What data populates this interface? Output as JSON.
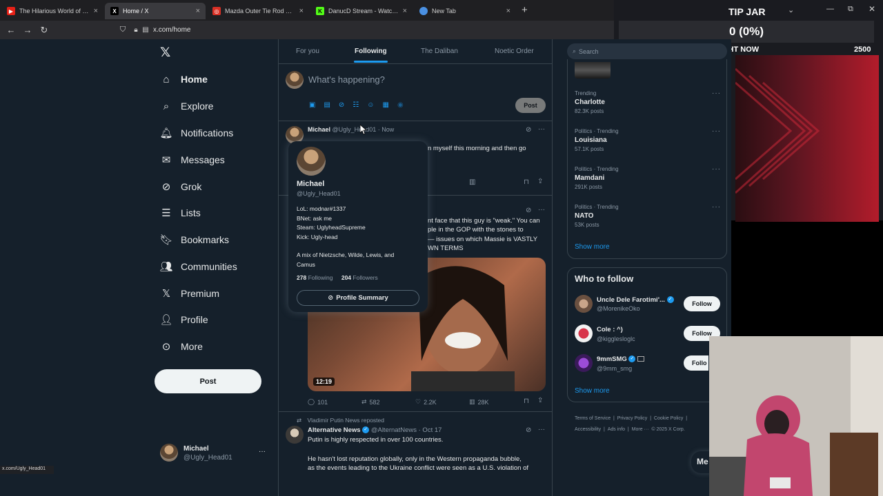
{
  "browser": {
    "tabs": [
      {
        "title": "The Hilarious World of Fun",
        "favicon": "youtube-icon",
        "color": "#e62117"
      },
      {
        "title": "Home / X",
        "favicon": "x-icon",
        "color": "#000000",
        "active": true
      },
      {
        "title": "Mazda Outer Tie Rod Replacem",
        "favicon": "red-icon",
        "color": "#d93025"
      },
      {
        "title": "DanucD Stream - Watch Li",
        "favicon": "kick-icon",
        "color": "#53fc18"
      },
      {
        "title": "New Tab",
        "favicon": "newtab-icon",
        "color": "#4a90e2"
      }
    ],
    "url": "x.com/home",
    "status_url": "x.com/Ugly_Head01"
  },
  "overlay": {
    "title": "TIP JAR",
    "amount": "0 (0%)",
    "min": "0",
    "label": "RIGHT NOW",
    "max": "2500"
  },
  "sidebar": {
    "items": [
      {
        "label": "Home",
        "icon": "home-icon"
      },
      {
        "label": "Explore",
        "icon": "search-icon"
      },
      {
        "label": "Notifications",
        "icon": "bell-icon"
      },
      {
        "label": "Messages",
        "icon": "mail-icon"
      },
      {
        "label": "Grok",
        "icon": "grok-icon"
      },
      {
        "label": "Lists",
        "icon": "list-icon"
      },
      {
        "label": "Bookmarks",
        "icon": "bookmark-icon"
      },
      {
        "label": "Communities",
        "icon": "communities-icon"
      },
      {
        "label": "Premium",
        "icon": "x-icon"
      },
      {
        "label": "Profile",
        "icon": "person-icon"
      },
      {
        "label": "More",
        "icon": "more-icon"
      }
    ],
    "post_label": "Post",
    "account": {
      "name": "Michael",
      "handle": "@Ugly_Head01"
    }
  },
  "feed": {
    "tabs": [
      "For you",
      "Following",
      "The Daliban",
      "Noetic Order"
    ],
    "compose_placeholder": "What's happening?",
    "post_label": "Post",
    "post1": {
      "name": "Michael",
      "handle": "@Ugly_Head01",
      "time": "· Now",
      "text_fragment": "n myself this morning and then go"
    },
    "post2": {
      "text1": "nt face that this guy is \"weak.\" You can",
      "text2": "ple in the GOP with the stones to",
      "text3": "— issues on which Massie is VASTLY",
      "text4": "WN TERMS",
      "video_duration": "12:19",
      "replies": "101",
      "reposts": "582",
      "likes": "2.2K",
      "views": "28K"
    },
    "post3": {
      "repost_label": "Vladimir Putin News reposted",
      "name": "Alternative News",
      "handle": "@AlternatNews",
      "time": "· Oct 17",
      "text1": "Putin is highly respected in over 100 countries.",
      "text2": "He hasn't lost reputation globally, only in the Western propaganda bubble,",
      "text3": "as the events leading to the Ukraine conflict were seen as a U.S. violation of"
    }
  },
  "popup": {
    "name": "Michael",
    "handle": "@Ugly_Head01",
    "bio": [
      "LoL: modnar#1337",
      "BNet: ask me",
      "Steam: UglyheadSupreme",
      "Kick: Ugly-head"
    ],
    "bio2": [
      "A mix of Nietzsche, Wilde, Lewis, and",
      "Camus"
    ],
    "following_count": "278",
    "following_label": "Following",
    "followers_count": "204",
    "followers_label": "Followers",
    "summary_label": "Profile Summary"
  },
  "right": {
    "search_placeholder": "Search",
    "trends": [
      {
        "meta": "Trending",
        "topic": "Charlotte",
        "posts": "82.3K posts"
      },
      {
        "meta": "Politics · Trending",
        "topic": "Louisiana",
        "posts": "57.1K posts"
      },
      {
        "meta": "Politics · Trending",
        "topic": "Mamdani",
        "posts": "291K posts"
      },
      {
        "meta": "Politics · Trending",
        "topic": "NATO",
        "posts": "53K posts"
      }
    ],
    "show_more": "Show more",
    "who_to_follow": "Who to follow",
    "follows": [
      {
        "name": "Uncle Dele Farotimi'...",
        "handle": "@MorenikeOko"
      },
      {
        "name": "Cole : ^)",
        "handle": "@kigglesloglc"
      },
      {
        "name": "9mmSMG",
        "handle": "@9mm_smg"
      }
    ],
    "follow_label": "Follow",
    "follow_label_cut": "Follo",
    "footer": [
      "Terms of Service",
      "Privacy Policy",
      "Cookie Policy",
      "Accessibility",
      "Ads info",
      "More ···",
      "© 2025 X Corp."
    ],
    "messages_cut": "Me"
  }
}
